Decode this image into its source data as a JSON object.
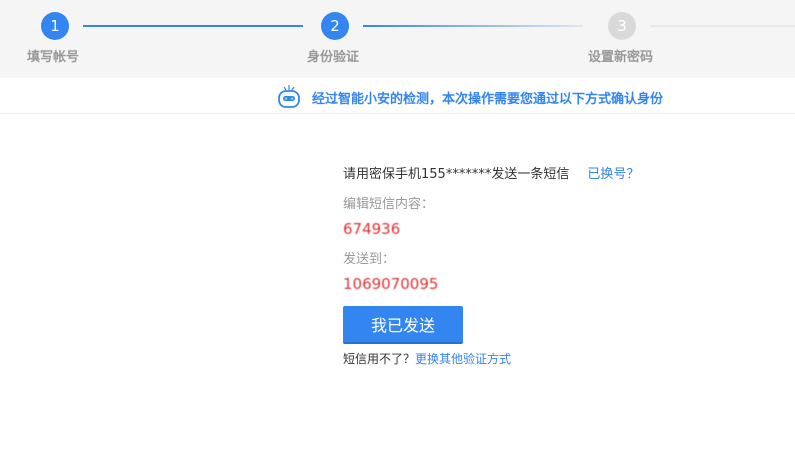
{
  "steps": [
    {
      "num": "1",
      "label": "填写帐号"
    },
    {
      "num": "2",
      "label": "身份验证"
    },
    {
      "num": "3",
      "label": "设置新密码"
    }
  ],
  "notice": {
    "text": "经过智能小安的检测，本次操作需要您通过以下方式确认身份",
    "icon": "robot-icon"
  },
  "sms": {
    "instruction": "请用密保手机155*******发送一条短信",
    "changed_link": "已换号？",
    "content_label": "编辑短信内容：",
    "content_value": "674936",
    "send_to_label": "发送到：",
    "send_to_value": "1069070095",
    "sent_button": "我已发送",
    "alt_prefix": "短信用不了？",
    "alt_link": "更换其他验证方式"
  },
  "colors": {
    "accent": "#3385f0",
    "value": "#e03030"
  }
}
